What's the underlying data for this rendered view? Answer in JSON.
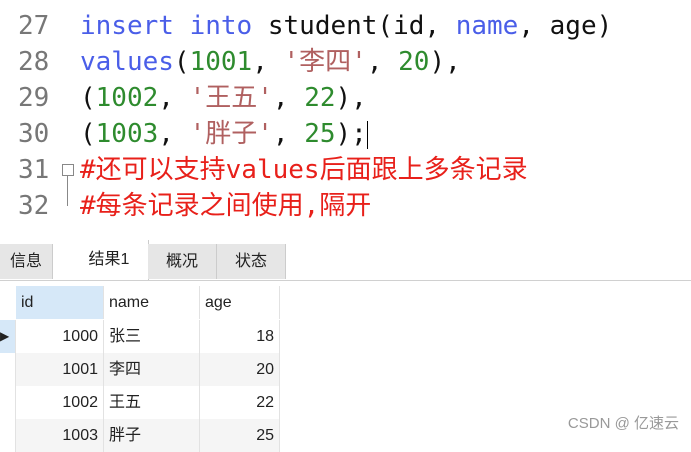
{
  "editor": {
    "lines": [
      {
        "n": "27",
        "parts": [
          [
            "kw",
            "insert"
          ],
          [
            "pl",
            " "
          ],
          [
            "kw",
            "into"
          ],
          [
            "pl",
            " student(id, "
          ],
          [
            "kw",
            "name"
          ],
          [
            "pl",
            ", age)"
          ]
        ]
      },
      {
        "n": "28",
        "parts": [
          [
            "kw",
            "values"
          ],
          [
            "pl",
            "("
          ],
          [
            "num",
            "1001"
          ],
          [
            "pl",
            ", "
          ],
          [
            "str",
            "'李四'"
          ],
          [
            "pl",
            ", "
          ],
          [
            "num",
            "20"
          ],
          [
            "pl",
            "),"
          ]
        ]
      },
      {
        "n": "29",
        "parts": [
          [
            "pl",
            "("
          ],
          [
            "num",
            "1002"
          ],
          [
            "pl",
            ", "
          ],
          [
            "str",
            "'王五'"
          ],
          [
            "pl",
            ", "
          ],
          [
            "num",
            "22"
          ],
          [
            "pl",
            "),"
          ]
        ]
      },
      {
        "n": "30",
        "parts": [
          [
            "pl",
            "("
          ],
          [
            "num",
            "1003"
          ],
          [
            "pl",
            ", "
          ],
          [
            "str",
            "'胖子'"
          ],
          [
            "pl",
            ", "
          ],
          [
            "num",
            "25"
          ],
          [
            "pl",
            ");"
          ]
        ]
      },
      {
        "n": "31",
        "parts": [
          [
            "cm",
            "#还可以支持values后面跟上多条记录"
          ]
        ]
      },
      {
        "n": "32",
        "parts": [
          [
            "cm",
            "#每条记录之间使用,隔开"
          ]
        ]
      }
    ]
  },
  "tabs": [
    "信息",
    "结果1",
    "概况",
    "状态"
  ],
  "active_tab": 1,
  "table": {
    "columns": [
      "id",
      "name",
      "age"
    ],
    "rows": [
      [
        "1000",
        "张三",
        "18"
      ],
      [
        "1001",
        "李四",
        "20"
      ],
      [
        "1002",
        "王五",
        "22"
      ],
      [
        "1003",
        "胖子",
        "25"
      ]
    ]
  },
  "watermark": "CSDN @ 亿速云"
}
